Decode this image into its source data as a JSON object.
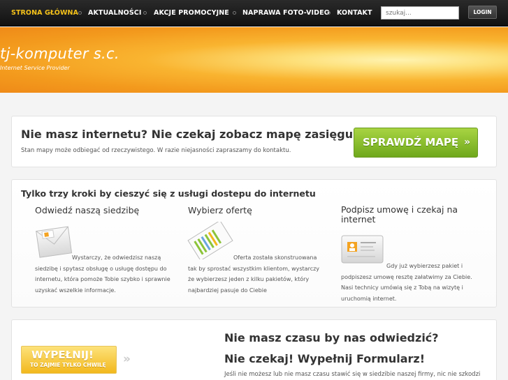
{
  "nav": {
    "items": [
      {
        "label": "STRONA GŁÓWNA",
        "active": true
      },
      {
        "label": "AKTUALNOŚCI"
      },
      {
        "label": "AKCJE PROMOCYJNE"
      },
      {
        "label": "NAPRAWA FOTO-VIDEO"
      },
      {
        "label": "KONTAKT"
      }
    ],
    "search_placeholder": "szukaj...",
    "login_label": "LOGIN"
  },
  "brand": {
    "title": "tj-komputer s.c.",
    "subtitle": "Internet Service Provider"
  },
  "map_box": {
    "heading": "Nie masz internetu? Nie czekaj zobacz mapę zasięgu!",
    "text": "Stan mapy może odbiegać od rzeczywistego. W razie niejasności zapraszamy do kontaktu.",
    "button": "SPRAWDŹ MAPĘ",
    "button_arrows": "»"
  },
  "steps": {
    "heading": "Tylko trzy kroki by cieszyć się z usługi dostepu do internetu",
    "items": [
      {
        "title": "Odwiedź naszą siedzibę",
        "text": "Wystarczy, że odwiedzisz naszą siedzibę i spytasz obsługę o usługę dostępu do internetu, która pomoże Tobie szybko i sprawnie uzyskać wszelkie informacje."
      },
      {
        "title": "Wybierz ofertę",
        "text": "Oferta została skonstruowana tak by sprostać wszystkim klientom, wystarczy że wybierzesz jeden z kilku pakietów, który najbardziej pasuje do Ciebie"
      },
      {
        "title": "Podpisz umowę i czekaj na internet",
        "text": "Gdy już wybierzesz pakiet i podpiszesz umowę resztę załatwimy za Ciebie. Nasi technicy umówią się z Tobą na wizytę i uruchomią internet."
      }
    ]
  },
  "form_box": {
    "button_big": "WYPEŁNIJ!",
    "button_small": "TO ZAJMIE TYLKO CHWILĘ",
    "arrows": "»",
    "heading1": "Nie masz czasu by nas odwiedzić?",
    "heading2": "Nie czekaj! Wypełnij Formularz!",
    "text": "Jeśli nie możesz lub nie masz czasu stawić się w siedzibie naszej firmy, nic nie szkodzi"
  },
  "colors": {
    "active_nav": "#f5c21a",
    "map_button": "#7cb526",
    "fill_button": "#f2b81d",
    "banner": "#f39a1d"
  }
}
